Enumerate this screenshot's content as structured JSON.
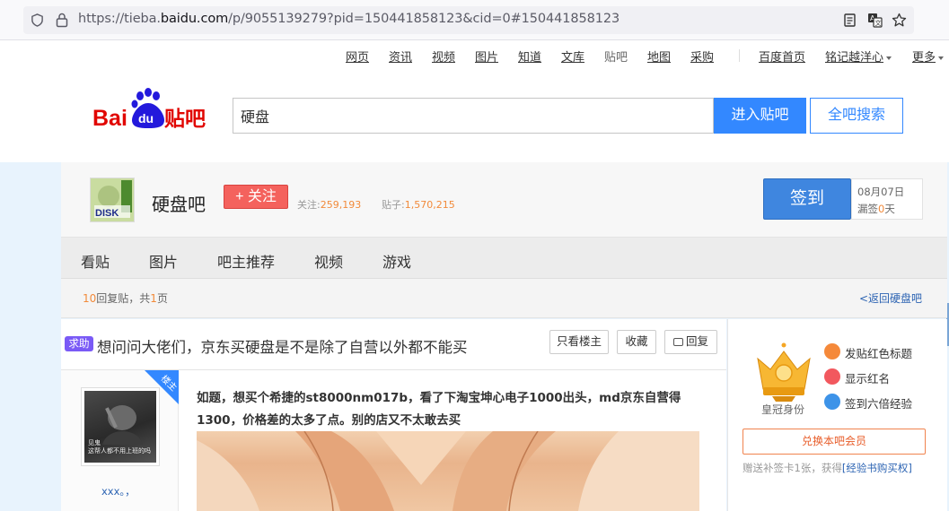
{
  "browser": {
    "url_prefix": "https://tieba.",
    "url_domain": "baidu.com",
    "url_suffix": "/p/9055139279?pid=150441858123&cid=0#150441858123"
  },
  "topnav": {
    "links": [
      "网页",
      "资讯",
      "视频",
      "图片",
      "知道",
      "文库",
      "贴吧",
      "地图",
      "采购"
    ],
    "home": "百度首页",
    "user": "铭记越洋心",
    "more": "更多"
  },
  "search": {
    "query": "硬盘",
    "enter_label": "进入贴吧",
    "all_label": "全吧搜索"
  },
  "logo": {
    "bai": "Bai",
    "du": "du",
    "tieba": "贴吧"
  },
  "forum": {
    "name": "硬盘吧",
    "follow_label": "+ 关注",
    "followers_label": "关注:",
    "followers": "259,193",
    "posts_label": "贴子:",
    "posts": "1,570,215",
    "sign_label": "签到",
    "date": "08月07日",
    "missed_prefix": "漏签",
    "missed_days": "0",
    "missed_suffix": "天"
  },
  "tabs": [
    "看贴",
    "图片",
    "吧主推荐",
    "视频",
    "游戏"
  ],
  "info": {
    "reply_count": "10",
    "reply_text": "回复贴，共",
    "page_count": "1",
    "page_text": "页",
    "back_link": "<返回硬盘吧"
  },
  "post": {
    "tag": "求助",
    "title": "想问问大佬们，京东买硬盘是不是除了自营以外都不能买",
    "only_op": "只看楼主",
    "collect": "收藏",
    "reply": "回复",
    "op_badge": "楼主",
    "author": "xxx。，",
    "avatar_caption_1": "见鬼",
    "avatar_caption_2": "这帮人都不用上班的吗",
    "content_line1": "如题，想买个希捷的st8000nm017b，看了下淘宝坤心电子1000出头，md京东自营得",
    "content_line2": "1300，价格差的太多了点。别的店又不太敢去买"
  },
  "sidebar": {
    "crown_label": "皇冠身份",
    "perks": [
      "发贴红色标题",
      "显示红名",
      "签到六倍经验"
    ],
    "member_button": "兑换本吧会员",
    "gift_text": "赠送补签卡1张，获得",
    "gift_link": "[经验书购买权]"
  },
  "colors": {
    "accent_blue": "#3388ff",
    "follow_red": "#f4625d",
    "number_orange": "#f28a3a",
    "help_tag_purple": "#7a5af6"
  }
}
